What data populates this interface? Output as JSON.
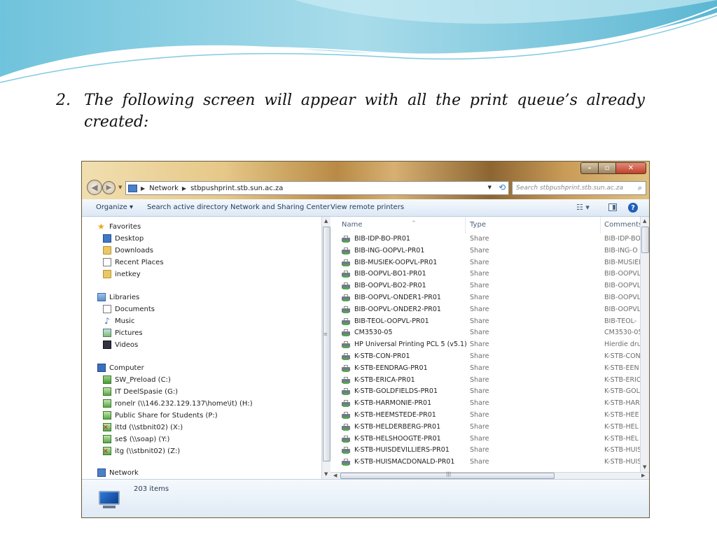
{
  "slide": {
    "step_number": "2.",
    "caption_line1": "The following screen will appear with all the print queue’s already",
    "caption_line2": "created:"
  },
  "window": {
    "address": {
      "segments": [
        "Network",
        "stbpushprint.stb.sun.ac.za"
      ]
    },
    "search_placeholder": "Search stbpushprint.stb.sun.ac.za",
    "toolbar": {
      "organize": "Organize ▾",
      "search_ad": "Search active directory",
      "network_sharing": "Network and Sharing Center",
      "view_remote": "View remote printers"
    },
    "nav": {
      "favorites": {
        "label": "Favorites",
        "items": [
          "Desktop",
          "Downloads",
          "Recent Places",
          "inetkey"
        ]
      },
      "libraries": {
        "label": "Libraries",
        "items": [
          "Documents",
          "Music",
          "Pictures",
          "Videos"
        ]
      },
      "computer": {
        "label": "Computer",
        "items": [
          "SW_Preload (C:)",
          "IT DeelSpasie (G:)",
          "ronelr (\\\\146.232.129.137\\home\\it) (H:)",
          "Public Share for Students (P:)",
          "ittd (\\\\stbnit02) (X:)",
          "se$ (\\\\soap) (Y:)",
          "itg (\\\\stbnit02) (Z:)"
        ]
      },
      "network": {
        "label": "Network"
      }
    },
    "columns": {
      "name": "Name",
      "type": "Type",
      "comments": "Comments"
    },
    "rows": [
      {
        "name": "BIB-IDP-BO-PR01",
        "type": "Share",
        "comments": "BIB-IDP-BO"
      },
      {
        "name": "BIB-ING-OOPVL-PR01",
        "type": "Share",
        "comments": "BIB-ING-O"
      },
      {
        "name": "BIB-MUSIEK-OOPVL-PR01",
        "type": "Share",
        "comments": "BIB-MUSIEK"
      },
      {
        "name": "BIB-OOPVL-BO1-PR01",
        "type": "Share",
        "comments": "BIB-OOPVL"
      },
      {
        "name": "BIB-OOPVL-BO2-PR01",
        "type": "Share",
        "comments": "BIB-OOPVL"
      },
      {
        "name": "BIB-OOPVL-ONDER1-PR01",
        "type": "Share",
        "comments": "BIB-OOPVL"
      },
      {
        "name": "BIB-OOPVL-ONDER2-PR01",
        "type": "Share",
        "comments": "BIB-OOPVL"
      },
      {
        "name": "BIB-TEOL-OOPVL-PR01",
        "type": "Share",
        "comments": "BIB-TEOL-"
      },
      {
        "name": "CM3530-05",
        "type": "Share",
        "comments": "CM3530-05"
      },
      {
        "name": "HP Universal Printing PCL 5 (v5.1)",
        "type": "Share",
        "comments": "Hierdie dru"
      },
      {
        "name": "K-STB-CON-PR01",
        "type": "Share",
        "comments": "K-STB-CON"
      },
      {
        "name": "K-STB-EENDRAG-PR01",
        "type": "Share",
        "comments": "K-STB-EEN"
      },
      {
        "name": "K-STB-ERICA-PR01",
        "type": "Share",
        "comments": "K-STB-ERIC"
      },
      {
        "name": "K-STB-GOLDFIELDS-PR01",
        "type": "Share",
        "comments": "K-STB-GOL"
      },
      {
        "name": "K-STB-HARMONIE-PR01",
        "type": "Share",
        "comments": "K-STB-HAR"
      },
      {
        "name": "K-STB-HEEMSTEDE-PR01",
        "type": "Share",
        "comments": "K-STB-HEE"
      },
      {
        "name": "K-STB-HELDERBERG-PR01",
        "type": "Share",
        "comments": "K-STB-HEL"
      },
      {
        "name": "K-STB-HELSHOOGTE-PR01",
        "type": "Share",
        "comments": "K-STB-HEL"
      },
      {
        "name": "K-STB-HUISDEVILLIERS-PR01",
        "type": "Share",
        "comments": "K-STB-HUIS"
      },
      {
        "name": "K-STB-HUISMACDONALD-PR01",
        "type": "Share",
        "comments": "K-STB-HUIS"
      }
    ],
    "status": {
      "item_count": "203 items"
    }
  }
}
